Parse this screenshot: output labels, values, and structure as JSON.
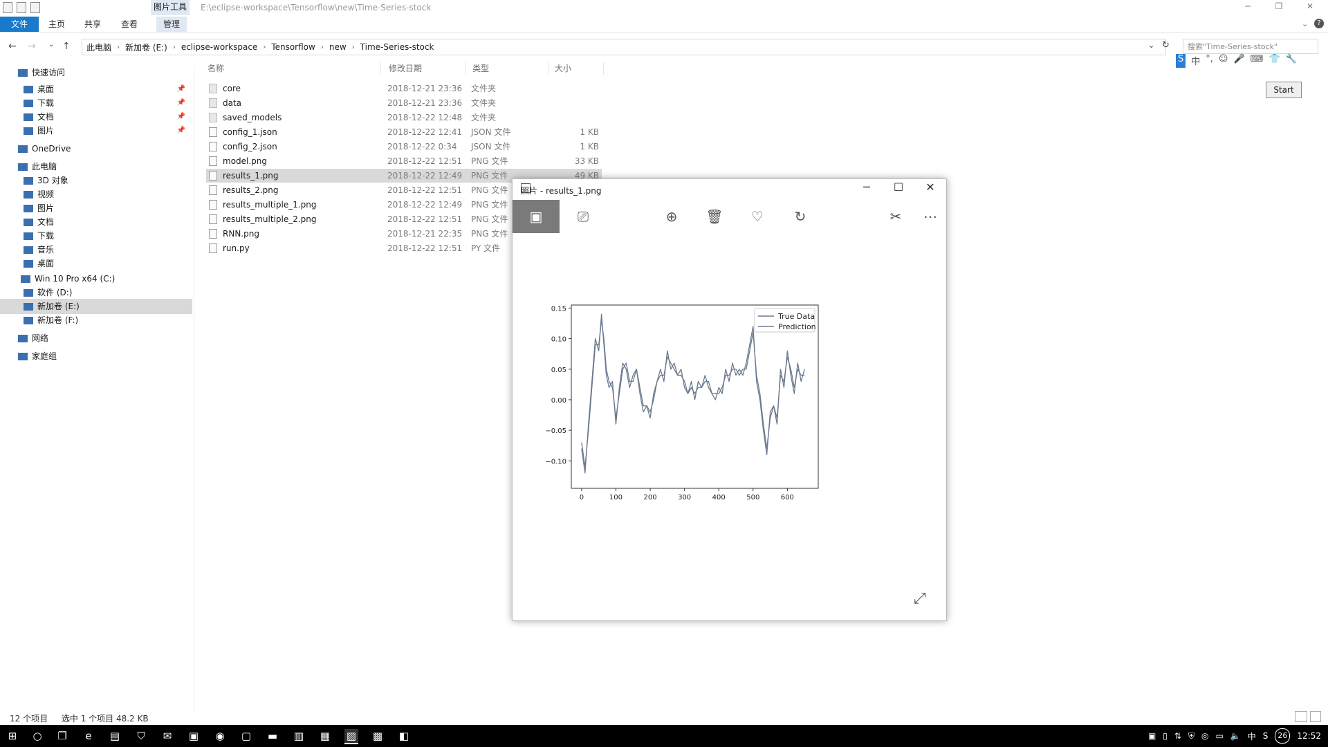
{
  "window": {
    "path_title": "E:\\eclipse-workspace\\Tensorflow\\new\\Time-Series-stock",
    "context_tool": "图片工具"
  },
  "ribbon": {
    "tabs": [
      "文件",
      "主页",
      "共享",
      "查看",
      "管理"
    ]
  },
  "address": {
    "crumbs": [
      "此电脑",
      "新加卷 (E:)",
      "eclipse-workspace",
      "Tensorflow",
      "new",
      "Time-Series-stock"
    ],
    "search_placeholder": "搜索\"Time-Series-stock\""
  },
  "navpane": {
    "items": [
      {
        "label": "快速访问",
        "pinned": false
      },
      {
        "label": "桌面",
        "pinned": true
      },
      {
        "label": "下载",
        "pinned": true
      },
      {
        "label": "文档",
        "pinned": true
      },
      {
        "label": "图片",
        "pinned": true
      },
      {
        "label": "OneDrive",
        "pinned": false
      },
      {
        "label": "此电脑",
        "pinned": false
      },
      {
        "label": "3D 对象",
        "pinned": false
      },
      {
        "label": "视频",
        "pinned": false
      },
      {
        "label": "图片",
        "pinned": false
      },
      {
        "label": "文档",
        "pinned": false
      },
      {
        "label": "下载",
        "pinned": false
      },
      {
        "label": "音乐",
        "pinned": false
      },
      {
        "label": "桌面",
        "pinned": false
      },
      {
        "label": "Win 10 Pro x64 (C:)",
        "pinned": false
      },
      {
        "label": "软件 (D:)",
        "pinned": false
      },
      {
        "label": "新加卷 (E:)",
        "pinned": false
      },
      {
        "label": "新加卷 (F:)",
        "pinned": false
      },
      {
        "label": "网络",
        "pinned": false
      },
      {
        "label": "家庭组",
        "pinned": false
      }
    ]
  },
  "columns": {
    "name": "名称",
    "date": "修改日期",
    "type": "类型",
    "size": "大小"
  },
  "files": [
    {
      "name": "core",
      "date": "2018-12-21 23:36",
      "type": "文件夹",
      "size": "",
      "kind": "folder"
    },
    {
      "name": "data",
      "date": "2018-12-21 23:36",
      "type": "文件夹",
      "size": "",
      "kind": "folder"
    },
    {
      "name": "saved_models",
      "date": "2018-12-22 12:48",
      "type": "文件夹",
      "size": "",
      "kind": "folder"
    },
    {
      "name": "config_1.json",
      "date": "2018-12-22 12:41",
      "type": "JSON 文件",
      "size": "1 KB",
      "kind": "file"
    },
    {
      "name": "config_2.json",
      "date": "2018-12-22 0:34",
      "type": "JSON 文件",
      "size": "1 KB",
      "kind": "file"
    },
    {
      "name": "model.png",
      "date": "2018-12-22 12:51",
      "type": "PNG 文件",
      "size": "33 KB",
      "kind": "file"
    },
    {
      "name": "results_1.png",
      "date": "2018-12-22 12:49",
      "type": "PNG 文件",
      "size": "49 KB",
      "kind": "file"
    },
    {
      "name": "results_2.png",
      "date": "2018-12-22 12:51",
      "type": "PNG 文件",
      "size": "",
      "kind": "file"
    },
    {
      "name": "results_multiple_1.png",
      "date": "2018-12-22 12:49",
      "type": "PNG 文件",
      "size": "",
      "kind": "file"
    },
    {
      "name": "results_multiple_2.png",
      "date": "2018-12-22 12:51",
      "type": "PNG 文件",
      "size": "",
      "kind": "file"
    },
    {
      "name": "RNN.png",
      "date": "2018-12-21 22:35",
      "type": "PNG 文件",
      "size": "",
      "kind": "file"
    },
    {
      "name": "run.py",
      "date": "2018-12-22 12:51",
      "type": "PY 文件",
      "size": "",
      "kind": "file"
    }
  ],
  "photo_window": {
    "title": "照片 - results_1.png"
  },
  "chart_data": {
    "type": "line",
    "title": "",
    "xlabel": "",
    "ylabel": "",
    "xlim": [
      -30,
      690
    ],
    "ylim": [
      -0.145,
      0.155
    ],
    "xticks": [
      0,
      100,
      200,
      300,
      400,
      500,
      600
    ],
    "yticks": [
      -0.1,
      -0.05,
      0.0,
      0.05,
      0.1,
      0.15
    ],
    "ytick_labels": [
      "−0.10",
      "−0.05",
      "0.00",
      "0.05",
      "0.10",
      "0.15"
    ],
    "legend_position": "top-right",
    "series": [
      {
        "name": "True Data",
        "color": "#6b7a8f",
        "x": [
          0,
          10,
          20,
          30,
          40,
          50,
          58,
          65,
          72,
          80,
          90,
          100,
          110,
          120,
          130,
          140,
          150,
          160,
          170,
          180,
          190,
          200,
          210,
          220,
          230,
          240,
          250,
          260,
          270,
          280,
          290,
          300,
          310,
          320,
          330,
          340,
          350,
          360,
          370,
          380,
          390,
          400,
          410,
          420,
          430,
          440,
          450,
          460,
          470,
          480,
          490,
          500,
          510,
          520,
          530,
          540,
          550,
          560,
          570,
          580,
          590,
          600,
          610,
          620,
          630,
          640,
          650
        ],
        "y": [
          -0.08,
          -0.12,
          -0.04,
          0.03,
          0.1,
          0.08,
          0.14,
          0.09,
          0.04,
          0.02,
          0.03,
          -0.04,
          0.02,
          0.06,
          0.05,
          0.02,
          0.04,
          0.05,
          0.01,
          -0.02,
          -0.01,
          -0.03,
          0.01,
          0.03,
          0.05,
          0.03,
          0.08,
          0.05,
          0.06,
          0.04,
          0.05,
          0.02,
          0.01,
          0.03,
          0.0,
          0.03,
          0.02,
          0.04,
          0.02,
          0.01,
          0.0,
          0.02,
          0.01,
          0.05,
          0.03,
          0.06,
          0.04,
          0.05,
          0.04,
          0.06,
          0.09,
          0.12,
          0.03,
          0.0,
          -0.05,
          -0.09,
          -0.02,
          -0.01,
          -0.04,
          0.05,
          0.02,
          0.08,
          0.04,
          0.01,
          0.06,
          0.03,
          0.05
        ]
      },
      {
        "name": "Prediction",
        "color": "#6b7a8f",
        "x": [
          0,
          10,
          20,
          30,
          40,
          50,
          58,
          65,
          72,
          80,
          90,
          100,
          110,
          120,
          130,
          140,
          150,
          160,
          170,
          180,
          190,
          200,
          210,
          220,
          230,
          240,
          250,
          260,
          270,
          280,
          290,
          300,
          310,
          320,
          330,
          340,
          350,
          360,
          370,
          380,
          390,
          400,
          410,
          420,
          430,
          440,
          450,
          460,
          470,
          480,
          490,
          500,
          510,
          520,
          530,
          540,
          550,
          560,
          570,
          580,
          590,
          600,
          610,
          620,
          630,
          640,
          650
        ],
        "y": [
          -0.07,
          -0.11,
          -0.05,
          0.02,
          0.09,
          0.09,
          0.13,
          0.1,
          0.05,
          0.03,
          0.02,
          -0.03,
          0.01,
          0.05,
          0.06,
          0.03,
          0.03,
          0.05,
          0.02,
          -0.01,
          -0.01,
          -0.02,
          0.0,
          0.03,
          0.04,
          0.04,
          0.07,
          0.06,
          0.05,
          0.04,
          0.04,
          0.03,
          0.01,
          0.02,
          0.01,
          0.02,
          0.02,
          0.03,
          0.03,
          0.01,
          0.01,
          0.01,
          0.02,
          0.04,
          0.04,
          0.05,
          0.05,
          0.04,
          0.05,
          0.05,
          0.08,
          0.11,
          0.04,
          0.01,
          -0.04,
          -0.08,
          -0.03,
          -0.01,
          -0.03,
          0.04,
          0.03,
          0.07,
          0.05,
          0.02,
          0.05,
          0.04,
          0.04
        ]
      }
    ]
  },
  "ime_widget": {
    "start_label": "Start",
    "lang": "中"
  },
  "statusbar": {
    "count": "12 个项目",
    "selected": "选中 1 个项目 48.2 KB"
  },
  "taskbar": {
    "lang": "中",
    "notifications": "26",
    "clock": "12:52"
  }
}
